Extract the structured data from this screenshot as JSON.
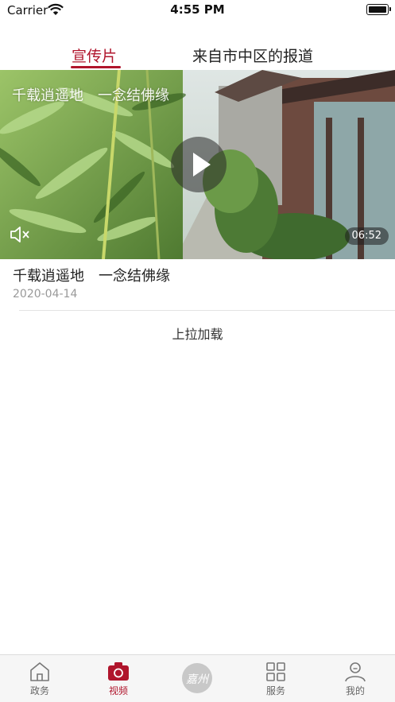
{
  "status_bar": {
    "carrier": "Carrier",
    "time": "4:55 PM"
  },
  "tabs": [
    {
      "label": "宣传片",
      "active": true
    },
    {
      "label": "来自市中区的报道",
      "active": false
    }
  ],
  "video": {
    "overlay_title": "千载逍遥地　一念结佛缘",
    "duration": "06:52"
  },
  "item": {
    "title": "千载逍遥地　一念结佛缘",
    "date": "2020-04-14"
  },
  "load_more": "上拉加载",
  "bottom_nav": [
    {
      "label": "政务",
      "icon": "home-icon"
    },
    {
      "label": "视频",
      "icon": "camera-icon",
      "active": true
    },
    {
      "label": "嘉州",
      "icon": "logo-icon"
    },
    {
      "label": "服务",
      "icon": "grid-icon"
    },
    {
      "label": "我的",
      "icon": "person-icon"
    }
  ],
  "colors": {
    "accent": "#b0152c",
    "inactive": "#666666",
    "tabbar_bg": "#f6f6f6"
  }
}
